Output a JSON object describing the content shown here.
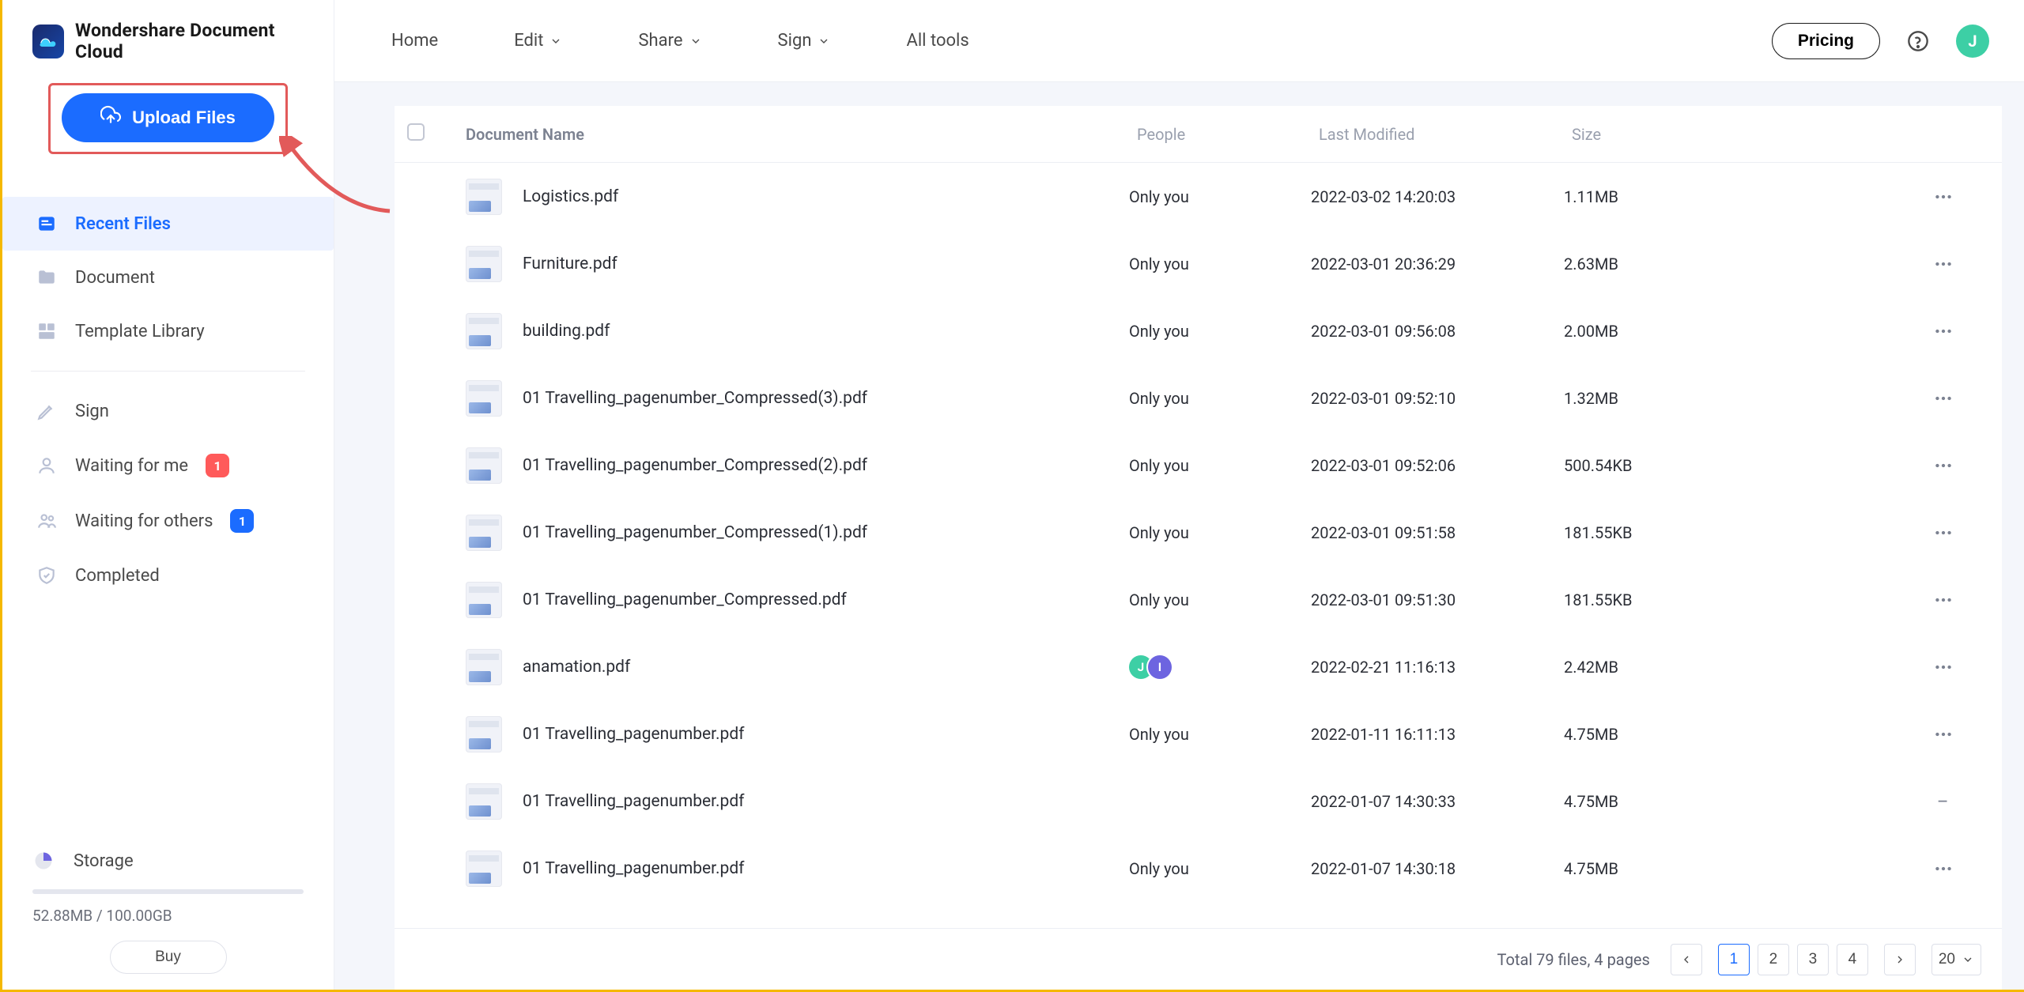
{
  "brand": {
    "name": "Wondershare Document Cloud"
  },
  "upload": {
    "label": "Upload Files"
  },
  "nav": {
    "recent": "Recent Files",
    "document": "Document",
    "templates": "Template Library",
    "sign": "Sign",
    "waiting_me": "Waiting for me",
    "waiting_me_badge": "1",
    "waiting_others": "Waiting for others",
    "waiting_others_badge": "1",
    "completed": "Completed"
  },
  "storage": {
    "label": "Storage",
    "text": "52.88MB / 100.00GB",
    "buy": "Buy"
  },
  "topnav": {
    "home": "Home",
    "edit": "Edit",
    "share": "Share",
    "sign": "Sign",
    "alltools": "All tools"
  },
  "topbar": {
    "pricing": "Pricing",
    "avatar": "J"
  },
  "table": {
    "headers": {
      "name": "Document Name",
      "people": "People",
      "modified": "Last Modified",
      "size": "Size"
    },
    "rows": [
      {
        "name": "Logistics.pdf",
        "people_text": "Only you",
        "people_avatars": null,
        "modified": "2022-03-02 14:20:03",
        "size": "1.11MB",
        "more": "dots"
      },
      {
        "name": "Furniture.pdf",
        "people_text": "Only you",
        "people_avatars": null,
        "modified": "2022-03-01 20:36:29",
        "size": "2.63MB",
        "more": "dots"
      },
      {
        "name": "building.pdf",
        "people_text": "Only you",
        "people_avatars": null,
        "modified": "2022-03-01 09:56:08",
        "size": "2.00MB",
        "more": "dots"
      },
      {
        "name": "01 Travelling_pagenumber_Compressed(3).pdf",
        "people_text": "Only you",
        "people_avatars": null,
        "modified": "2022-03-01 09:52:10",
        "size": "1.32MB",
        "more": "dots"
      },
      {
        "name": "01 Travelling_pagenumber_Compressed(2).pdf",
        "people_text": "Only you",
        "people_avatars": null,
        "modified": "2022-03-01 09:52:06",
        "size": "500.54KB",
        "more": "dots"
      },
      {
        "name": "01 Travelling_pagenumber_Compressed(1).pdf",
        "people_text": "Only you",
        "people_avatars": null,
        "modified": "2022-03-01 09:51:58",
        "size": "181.55KB",
        "more": "dots"
      },
      {
        "name": "01 Travelling_pagenumber_Compressed.pdf",
        "people_text": "Only you",
        "people_avatars": null,
        "modified": "2022-03-01 09:51:30",
        "size": "181.55KB",
        "more": "dots"
      },
      {
        "name": "anamation.pdf",
        "people_text": "",
        "people_avatars": [
          "J",
          "I"
        ],
        "modified": "2022-02-21 11:16:13",
        "size": "2.42MB",
        "more": "dots"
      },
      {
        "name": "01 Travelling_pagenumber.pdf",
        "people_text": "Only you",
        "people_avatars": null,
        "modified": "2022-01-11 16:11:13",
        "size": "4.75MB",
        "more": "dots"
      },
      {
        "name": "01 Travelling_pagenumber.pdf",
        "people_text": "",
        "people_avatars": null,
        "modified": "2022-01-07 14:30:33",
        "size": "4.75MB",
        "more": "dash"
      },
      {
        "name": "01 Travelling_pagenumber.pdf",
        "people_text": "Only you",
        "people_avatars": null,
        "modified": "2022-01-07 14:30:18",
        "size": "4.75MB",
        "more": "dots"
      }
    ]
  },
  "pagination": {
    "total": "Total 79 files, 4 pages",
    "pages": [
      "1",
      "2",
      "3",
      "4"
    ],
    "active": "1",
    "pagesize": "20"
  }
}
